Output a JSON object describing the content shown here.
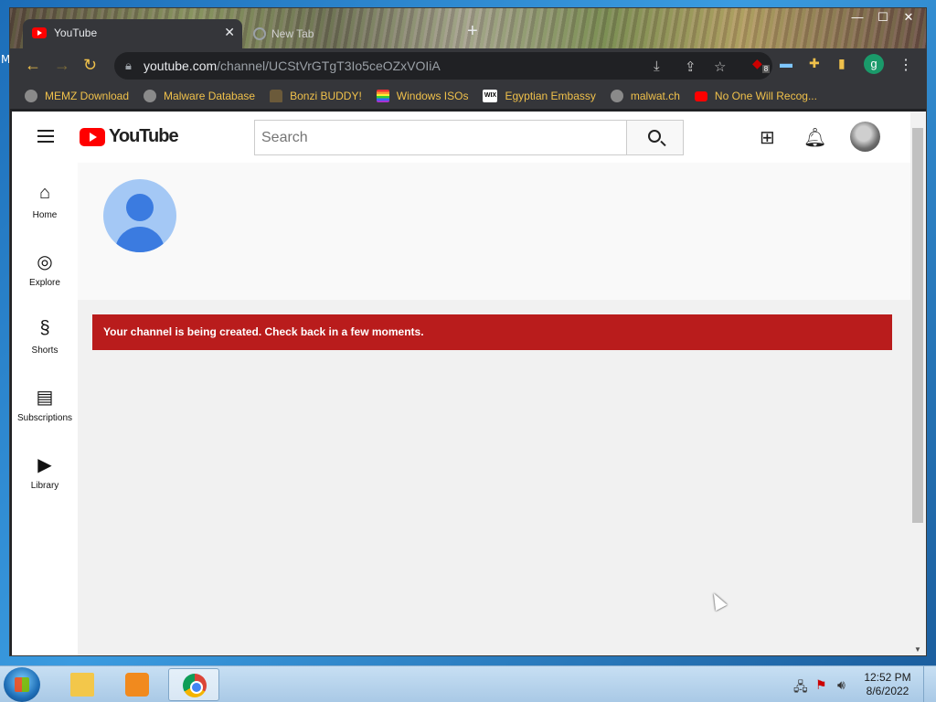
{
  "browser": {
    "tabs": [
      {
        "title": "YouTube",
        "active": true
      },
      {
        "title": "New Tab",
        "active": false
      }
    ],
    "new_tab_glyph": "+",
    "window_controls": {
      "minimize": "—",
      "maximize": "☐",
      "close": "✕"
    },
    "address": {
      "host": "youtube.com",
      "path": "/channel/UCStVrGTgT3Io5ceOZxVOIiA"
    },
    "profile_initial": "g",
    "extension_badge": "8",
    "bookmarks": [
      {
        "label": "MEMZ Download",
        "icon": "globe-icon"
      },
      {
        "label": "Malware Database",
        "icon": "globe-icon"
      },
      {
        "label": "Bonzi BUDDY!",
        "icon": "bonzi-icon"
      },
      {
        "label": "Windows ISOs",
        "icon": "rainbow-flag-icon"
      },
      {
        "label": "Egyptian Embassy",
        "icon": "wix-icon"
      },
      {
        "label": "malwat.ch",
        "icon": "globe-icon"
      },
      {
        "label": "No One Will Recog...",
        "icon": "youtube-icon"
      }
    ]
  },
  "youtube": {
    "logo_text": "YouTube",
    "search_placeholder": "Search",
    "sidebar": [
      {
        "label": "Home",
        "icon": "⌂"
      },
      {
        "label": "Explore",
        "icon": "◎"
      },
      {
        "label": "Shorts",
        "icon": "§"
      },
      {
        "label": "Subscriptions",
        "icon": "▤"
      },
      {
        "label": "Library",
        "icon": "▶"
      }
    ],
    "alert_text": "Your channel is being created. Check back in a few moments."
  },
  "desktop": {
    "edge_letter": "M"
  },
  "taskbar": {
    "time": "12:52 PM",
    "date": "8/6/2022"
  },
  "colors": {
    "alert_bg": "#b91c1c",
    "youtube_red": "#ff0000",
    "bookmark_text": "#f0c14b"
  }
}
